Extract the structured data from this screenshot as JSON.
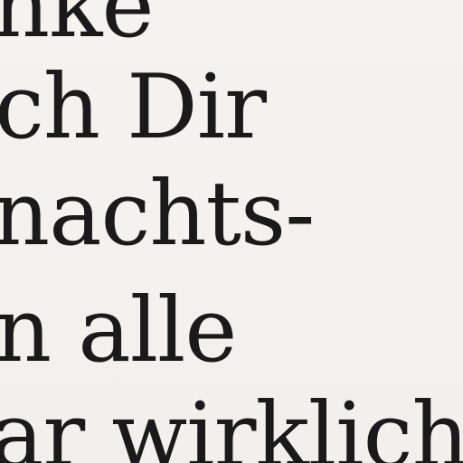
{
  "document": {
    "lines": [
      "nke",
      "ch Dir",
      "nachts-",
      "n alle",
      "ar wirklich"
    ]
  }
}
